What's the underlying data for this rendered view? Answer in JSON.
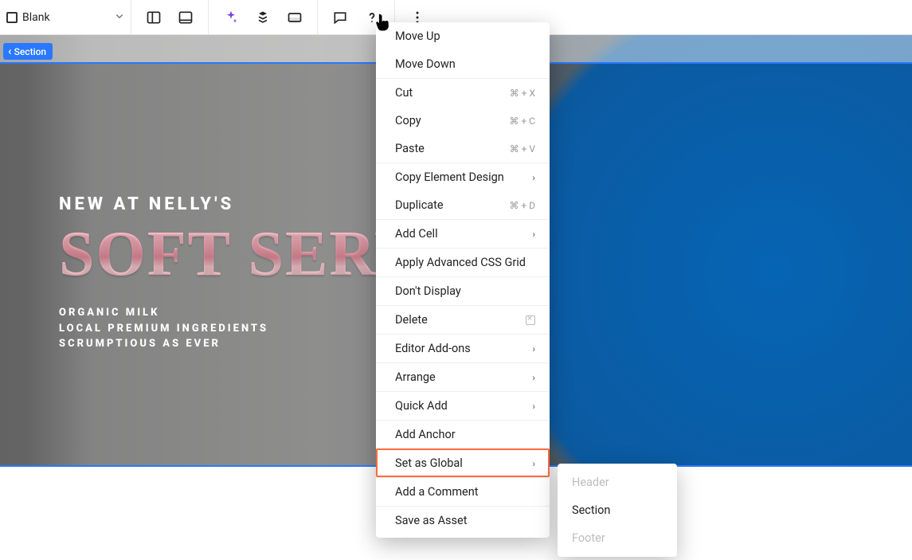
{
  "toolbar": {
    "section_label": "Blank"
  },
  "section_tab": "Section",
  "hero": {
    "eyebrow": "NEW AT NELLY'S",
    "title": "SOFT SERVE",
    "line1": "ORGANIC MILK",
    "line2": "LOCAL PREMIUM INGREDIENTS",
    "line3": "SCRUMPTIOUS AS EVER"
  },
  "menu": {
    "move_up": "Move Up",
    "move_down": "Move Down",
    "cut": "Cut",
    "cut_sc": "⌘ + X",
    "copy": "Copy",
    "copy_sc": "⌘ + C",
    "paste": "Paste",
    "paste_sc": "⌘ + V",
    "copy_design": "Copy Element Design",
    "duplicate": "Duplicate",
    "duplicate_sc": "⌘ + D",
    "add_cell": "Add Cell",
    "apply_grid": "Apply Advanced CSS Grid",
    "dont_display": "Don't Display",
    "delete": "Delete",
    "addons": "Editor Add-ons",
    "arrange": "Arrange",
    "quick_add": "Quick Add",
    "add_anchor": "Add Anchor",
    "set_global": "Set as Global",
    "add_comment": "Add a Comment",
    "save_asset": "Save as Asset"
  },
  "submenu": {
    "header": "Header",
    "section": "Section",
    "footer": "Footer"
  }
}
